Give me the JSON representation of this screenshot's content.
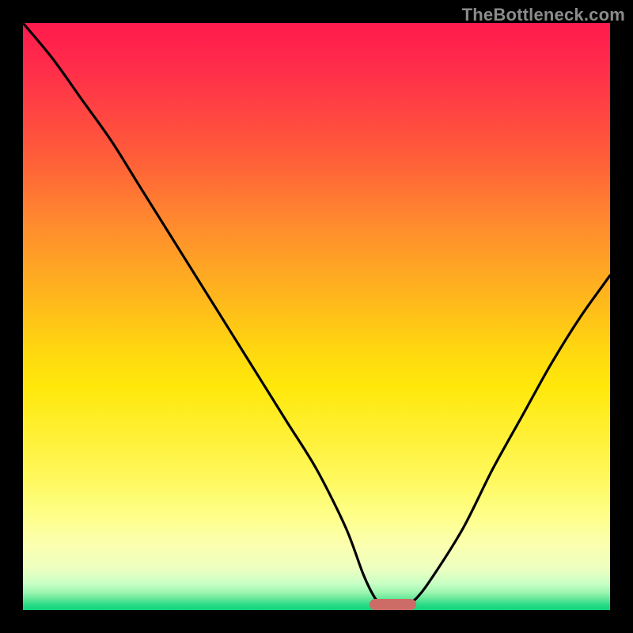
{
  "watermark": "TheBottleneck.com",
  "colors": {
    "frame": "#000000",
    "curve": "#000000",
    "marker": "#cd6b67"
  },
  "chart_data": {
    "type": "line",
    "title": "",
    "xlabel": "",
    "ylabel": "",
    "xlim": [
      0,
      100
    ],
    "ylim": [
      0,
      100
    ],
    "grid": false,
    "legend": false,
    "background": "heatmap-gradient",
    "x": [
      0,
      5,
      10,
      15,
      20,
      25,
      30,
      35,
      40,
      45,
      50,
      55,
      58,
      60,
      62,
      64,
      67,
      70,
      75,
      80,
      85,
      90,
      95,
      100
    ],
    "values": [
      100,
      94,
      87,
      80,
      72,
      64,
      56,
      48,
      40,
      32,
      24,
      14,
      6,
      2,
      0,
      0,
      2,
      6,
      14,
      24,
      33,
      42,
      50,
      57
    ],
    "annotations": [
      {
        "type": "marker",
        "shape": "pill",
        "x_start": 59,
        "x_end": 67,
        "y": 0,
        "color": "#cd6b67"
      }
    ]
  }
}
